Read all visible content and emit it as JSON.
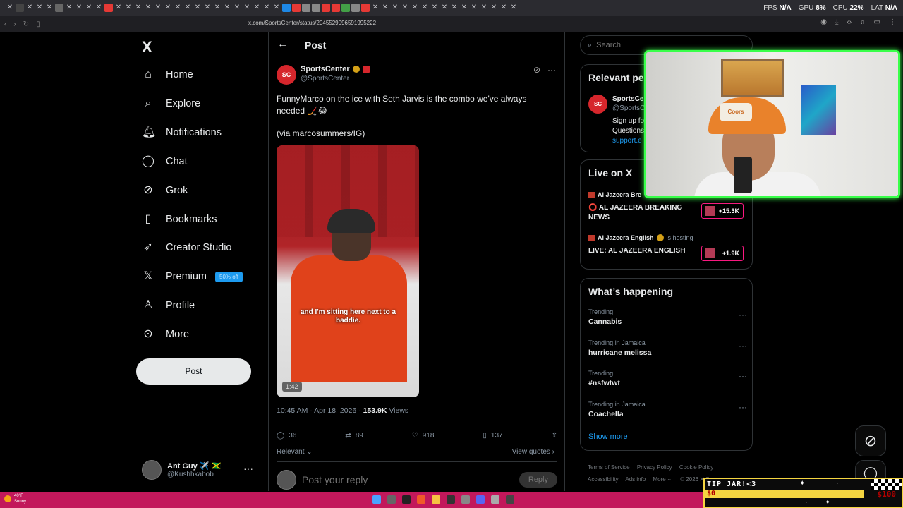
{
  "system": {
    "fps_label": "FPS",
    "fps_value": "N/A",
    "gpu_label": "GPU",
    "gpu_value": "8%",
    "cpu_label": "CPU",
    "cpu_value": "22%",
    "lat_label": "LAT",
    "lat_value": "N/A"
  },
  "browser": {
    "url": "x.com/SportsCenter/status/2045529096591995222"
  },
  "nav": {
    "logo": "X",
    "items": [
      {
        "label": "Home",
        "icon": "home-icon"
      },
      {
        "label": "Explore",
        "icon": "search-icon"
      },
      {
        "label": "Notifications",
        "icon": "bell-icon"
      },
      {
        "label": "Chat",
        "icon": "chat-icon"
      },
      {
        "label": "Grok",
        "icon": "grok-icon"
      },
      {
        "label": "Bookmarks",
        "icon": "bookmark-icon"
      },
      {
        "label": "Creator Studio",
        "icon": "rocket-icon"
      },
      {
        "label": "Premium",
        "icon": "x-icon"
      },
      {
        "label": "Profile",
        "icon": "person-icon"
      },
      {
        "label": "More",
        "icon": "more-circle-icon"
      }
    ],
    "premium_badge": "50% off",
    "post_button": "Post",
    "account": {
      "name": "Ant Guy ✈️ 🇯🇲",
      "handle": "@Kushhkabob"
    }
  },
  "post": {
    "header": "Post",
    "author_name": "SportsCenter",
    "author_handle": "@SportsCenter",
    "avatar_text": "SC",
    "text": "FunnyMarco on the ice with Seth Jarvis is the combo we've always needed 🏒😂",
    "via": "(via marcosummers/IG)",
    "video_caption": "and I'm sitting here next to a baddie.",
    "duration": "1:42",
    "time": "10:45 AM · Apr 18, 2026 · ",
    "views_count": "153.9K",
    "views_label": " Views",
    "replies": "36",
    "reposts": "89",
    "likes": "918",
    "bookmarks": "137",
    "relevant": "Relevant",
    "view_quotes": "View quotes",
    "reply_placeholder": "Post your reply",
    "reply_button": "Reply"
  },
  "right": {
    "search_placeholder": "Search",
    "relevant_title": "Relevant pe",
    "rel_name": "SportsCe",
    "rel_handle": "@SportsC",
    "rel_bio1": "Sign up fo",
    "rel_bio2": "Questions",
    "rel_link": "support.e",
    "live_title": "Live on X",
    "live": [
      {
        "host": "Al Jazeera Bre",
        "host_suffix": "",
        "title": "⭕ AL JAZEERA BREAKING NEWS",
        "count": "+15.3K"
      },
      {
        "host": "Al Jazeera English",
        "host_suffix": "is hosting",
        "title": "LIVE: AL JAZEERA ENGLISH",
        "count": "+1.9K"
      }
    ],
    "happening_title": "What’s happening",
    "trends": [
      {
        "context": "Trending",
        "name": "Cannabis"
      },
      {
        "context": "Trending in Jamaica",
        "name": "hurricane melissa"
      },
      {
        "context": "Trending",
        "name": "#nsfwtwt"
      },
      {
        "context": "Trending in Jamaica",
        "name": "Coachella"
      }
    ],
    "show_more": "Show more",
    "footer": [
      "Terms of Service",
      "Privacy Policy",
      "Cookie Policy",
      "Accessibility",
      "Ads info",
      "More ···",
      "© 2026 X Corp."
    ]
  },
  "webcam": {
    "cap_text": "Coors"
  },
  "tipjar": {
    "label": "TIP JAR!<3",
    "current": "$0",
    "goal": "$100"
  },
  "taskbar": {
    "temp": "40°F",
    "condition": "Sunny"
  },
  "colors": {
    "accent": "#1d9bf0",
    "webcam_border": "#39ff4a",
    "taskbar": "#c2185b",
    "tipjar": "#f4d541"
  }
}
